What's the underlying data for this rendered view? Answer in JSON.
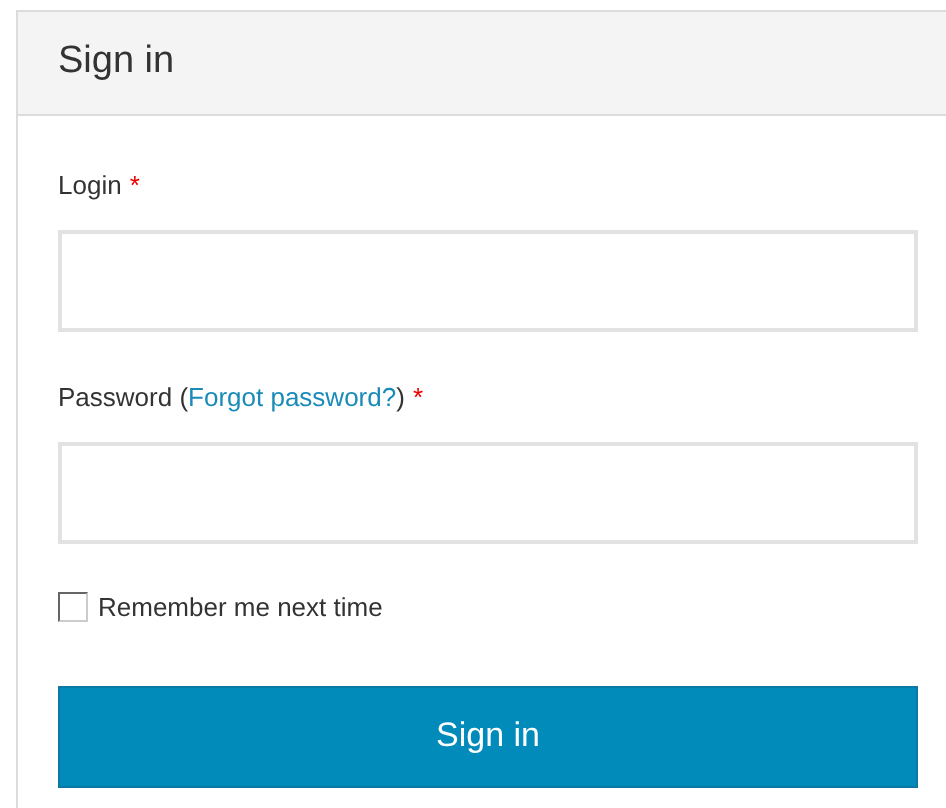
{
  "panel": {
    "title": "Sign in"
  },
  "fields": [
    {
      "label": "Login",
      "required_mark": "*"
    },
    {
      "label": "Password",
      "label_after": " (",
      "link": "Forgot password?",
      "link_after": ")",
      "required_mark": "*"
    }
  ],
  "remember": {
    "label": "Remember me next time",
    "checked": false
  },
  "submit": {
    "label": "Sign in"
  }
}
